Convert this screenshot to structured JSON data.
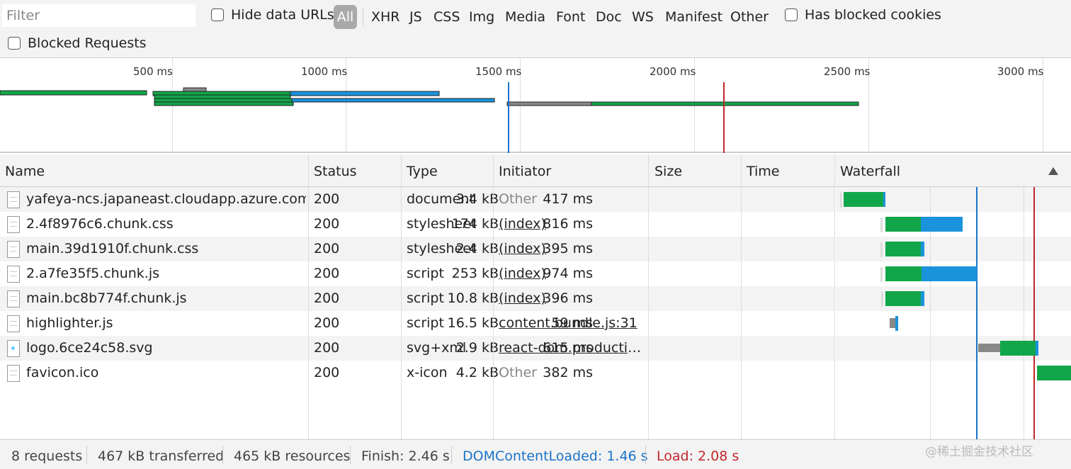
{
  "toolbar": {
    "filter_placeholder": "Filter",
    "hide_data_urls": "Hide data URLs",
    "types": [
      "All",
      "XHR",
      "JS",
      "CSS",
      "Img",
      "Media",
      "Font",
      "Doc",
      "WS",
      "Manifest",
      "Other"
    ],
    "has_blocked_cookies": "Has blocked cookies",
    "blocked_requests": "Blocked Requests"
  },
  "overview": {
    "ticks": [
      "500 ms",
      "1000 ms",
      "1500 ms",
      "2000 ms",
      "2500 ms",
      "3000 ms"
    ]
  },
  "table": {
    "headers": [
      "Name",
      "Status",
      "Type",
      "Initiator",
      "Size",
      "Time",
      "Waterfall"
    ],
    "rows": [
      {
        "name": "yafeya-ncs.japaneast.cloudapp.azure.com",
        "status": "200",
        "type": "document",
        "initiator": "Other",
        "size": "3.4 kB",
        "time": "417 ms"
      },
      {
        "name": "2.4f8976c6.chunk.css",
        "status": "200",
        "type": "stylesheet",
        "initiator": "(index)",
        "size": "174 kB",
        "time": "816 ms"
      },
      {
        "name": "main.39d1910f.chunk.css",
        "status": "200",
        "type": "stylesheet",
        "initiator": "(index)",
        "size": "2.4 kB",
        "time": "395 ms"
      },
      {
        "name": "2.a7fe35f5.chunk.js",
        "status": "200",
        "type": "script",
        "initiator": "(index)",
        "size": "253 kB",
        "time": "974 ms"
      },
      {
        "name": "main.bc8b774f.chunk.js",
        "status": "200",
        "type": "script",
        "initiator": "(index)",
        "size": "10.8 kB",
        "time": "396 ms"
      },
      {
        "name": "highlighter.js",
        "status": "200",
        "type": "script",
        "initiator": "content.bundle.js:31",
        "size": "16.5 kB",
        "time": "59 ms"
      },
      {
        "name": "logo.6ce24c58.svg",
        "status": "200",
        "type": "svg+xml",
        "initiator": "react-dom.productio...",
        "size": "2.9 kB",
        "time": "615 ms"
      },
      {
        "name": "favicon.ico",
        "status": "200",
        "type": "x-icon",
        "initiator": "Other",
        "size": "4.2 kB",
        "time": "382 ms"
      }
    ]
  },
  "status": {
    "requests": "8 requests",
    "transferred": "467 kB transferred",
    "resources": "465 kB resources",
    "finish": "Finish: 2.46 s",
    "dom_content_loaded": "DOMContentLoaded: 1.46 s",
    "load": "Load: 2.08 s"
  },
  "watermark": "@稀土掘金技术社区",
  "colors": {
    "waiting_green": "#12a64a",
    "download_blue": "#1a93dc",
    "queued_gray": "#888888",
    "dcl_line": "#1a73c8",
    "load_line": "#c0282d"
  }
}
